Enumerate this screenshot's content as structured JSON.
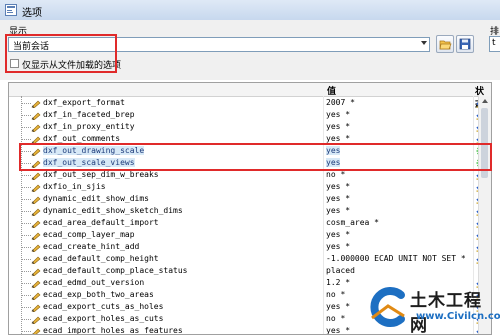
{
  "window": {
    "title": "选项"
  },
  "filter": {
    "label": "显示",
    "selected": "当前会话",
    "side_label": "排",
    "side_value": "t",
    "checkbox_label": "仅显示从文件加载的选项",
    "checkbox_checked": false
  },
  "table": {
    "columns": {
      "name": "",
      "value": "值",
      "status": "状态"
    },
    "rows": [
      {
        "name": "dxf_export_format",
        "value": "2007 *",
        "status": "check",
        "highlighted": false
      },
      {
        "name": "dxf_in_faceted_brep",
        "value": "yes *",
        "status": "check",
        "highlighted": false
      },
      {
        "name": "dxf_in_proxy_entity",
        "value": "yes *",
        "status": "check",
        "highlighted": false
      },
      {
        "name": "dxf_out_comments",
        "value": "yes *",
        "status": "check",
        "highlighted": false
      },
      {
        "name": "dxf_out_drawing_scale",
        "value": "yes",
        "status": "star",
        "highlighted": true
      },
      {
        "name": "dxf_out_scale_views",
        "value": "yes",
        "status": "star",
        "highlighted": true
      },
      {
        "name": "dxf_out_sep_dim_w_breaks",
        "value": "no *",
        "status": "check",
        "highlighted": false
      },
      {
        "name": "dxfio_in_sjis",
        "value": "yes *",
        "status": "check",
        "highlighted": false
      },
      {
        "name": "dynamic_edit_show_dims",
        "value": "yes *",
        "status": "check",
        "highlighted": false
      },
      {
        "name": "dynamic_edit_show_sketch_dims",
        "value": "yes *",
        "status": "check",
        "highlighted": false
      },
      {
        "name": "ecad_area_default_import",
        "value": "cosm_area *",
        "status": "check",
        "highlighted": false
      },
      {
        "name": "ecad_comp_layer_map",
        "value": "yes *",
        "status": "check",
        "highlighted": false
      },
      {
        "name": "ecad_create_hint_add",
        "value": "yes *",
        "status": "check",
        "highlighted": false
      },
      {
        "name": "ecad_default_comp_height",
        "value": "-1.000000 ECAD UNIT NOT SET *",
        "status": "check",
        "highlighted": false
      },
      {
        "name": "ecad_default_comp_place_status",
        "value": "placed",
        "status": "none",
        "highlighted": false
      },
      {
        "name": "ecad_edmd_out_version",
        "value": "1.2 *",
        "status": "check",
        "highlighted": false
      },
      {
        "name": "ecad_exp_both_two_areas",
        "value": "no *",
        "status": "check",
        "highlighted": false
      },
      {
        "name": "ecad_export_cuts_as_holes",
        "value": "yes *",
        "status": "check",
        "highlighted": false
      },
      {
        "name": "ecad_export_holes_as_cuts",
        "value": "no *",
        "status": "check",
        "highlighted": false
      },
      {
        "name": "ecad_import_holes_as_features",
        "value": "yes *",
        "status": "check",
        "highlighted": false
      }
    ]
  },
  "watermark": {
    "main": "土木工程网",
    "sub": "www.Civilcn.com"
  },
  "colors": {
    "annotation": "#e02a2a",
    "row_highlight": "#d7e9f7",
    "status_star": "#3fbf3f",
    "status_check": "#2b5fc7"
  }
}
